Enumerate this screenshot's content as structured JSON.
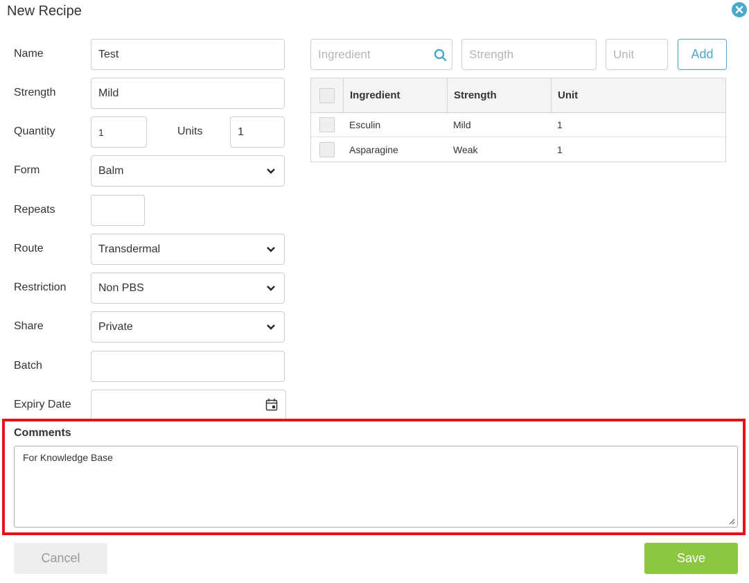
{
  "dialog": {
    "title": "New Recipe"
  },
  "form": {
    "name_label": "Name",
    "name_value": "Test",
    "strength_label": "Strength",
    "strength_value": "Mild",
    "quantity_label": "Quantity",
    "quantity_value": "1",
    "units_label": "Units",
    "units_value": "1",
    "form_label": "Form",
    "form_value": "Balm",
    "repeats_label": "Repeats",
    "repeats_value": "",
    "route_label": "Route",
    "route_value": "Transdermal",
    "restriction_label": "Restriction",
    "restriction_value": "Non PBS",
    "share_label": "Share",
    "share_value": "Private",
    "batch_label": "Batch",
    "batch_value": "",
    "expiry_label": "Expiry Date",
    "expiry_value": ""
  },
  "ingredient_entry": {
    "ingredient_placeholder": "Ingredient",
    "strength_placeholder": "Strength",
    "unit_placeholder": "Unit",
    "add_label": "Add"
  },
  "ingredients_table": {
    "headers": {
      "ingredient": "Ingredient",
      "strength": "Strength",
      "unit": "Unit"
    },
    "rows": [
      {
        "ingredient": "Esculin",
        "strength": "Mild",
        "unit": "1"
      },
      {
        "ingredient": "Asparagine",
        "strength": "Weak",
        "unit": "1"
      }
    ]
  },
  "comments": {
    "label": "Comments",
    "value": "For Knowledge Base"
  },
  "actions": {
    "cancel_label": "Cancel",
    "save_label": "Save"
  },
  "colors": {
    "accent": "#4aa8c8",
    "save": "#8dc63f",
    "highlight": "#e8141b"
  },
  "icons": {
    "close": "close-icon",
    "search": "search-icon",
    "chevron": "chevron-down-icon",
    "calendar": "calendar-icon",
    "resize": "resize-grip-icon"
  }
}
